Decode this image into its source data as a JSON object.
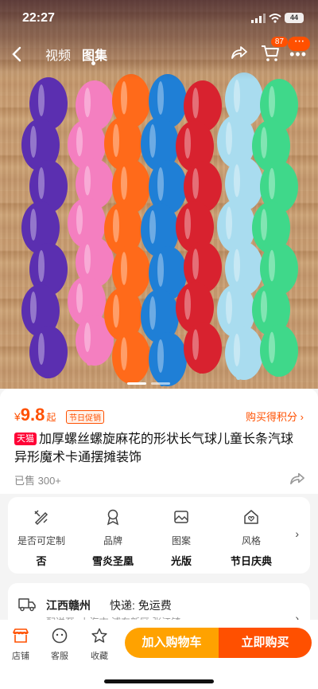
{
  "status_bar": {
    "time": "22:27",
    "battery": "44"
  },
  "nav": {
    "tabs": [
      {
        "label": "视频"
      },
      {
        "label": "图集"
      }
    ],
    "cart_count": "87"
  },
  "product": {
    "currency": "¥",
    "price": "9.8",
    "price_suffix": "起",
    "promo_tag": "节日促销",
    "points_link": "购买得积分 ›",
    "store_tag": "天猫",
    "title": "加厚螺丝螺旋麻花的形状长气球儿童长条汽球异形魔术卡通摆摊装饰",
    "sold": "已售 300+",
    "balloon_colors": [
      "#5b2fb0",
      "#f47fc0",
      "#ff6a1a",
      "#1f7fd6",
      "#d8222f",
      "#a9dcef",
      "#3fd88a"
    ]
  },
  "attributes": {
    "items": [
      {
        "icon": "pencil-ruler-icon",
        "key": "是否可定制",
        "value": "否"
      },
      {
        "icon": "award-icon",
        "key": "品牌",
        "value": "雪炎圣凰"
      },
      {
        "icon": "picture-icon",
        "key": "图案",
        "value": "光版"
      },
      {
        "icon": "house-heart-icon",
        "key": "风格",
        "value": "节日庆典"
      }
    ]
  },
  "shipping": {
    "origin": "江西赣州",
    "fee": "快递: 免运费",
    "destination": "配送至: 上海市 浦东新区 张江镇"
  },
  "bottom_bar": {
    "store": "店铺",
    "service": "客服",
    "favorite": "收藏",
    "add_to_cart": "加入购物车",
    "buy_now": "立即购买"
  }
}
